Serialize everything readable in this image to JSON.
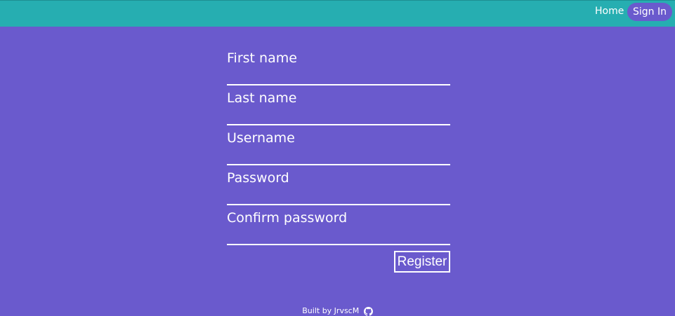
{
  "colors": {
    "background": "#6a5acd",
    "navbar": "#26aeb1",
    "text": "#ffffff"
  },
  "nav": {
    "home_label": "Home",
    "signin_label": "Sign In"
  },
  "form": {
    "fields": [
      {
        "label": "First name",
        "value": ""
      },
      {
        "label": "Last name",
        "value": ""
      },
      {
        "label": "Username",
        "value": ""
      },
      {
        "label": "Password",
        "value": ""
      },
      {
        "label": "Confirm password",
        "value": ""
      }
    ],
    "register_label": "Register"
  },
  "footer": {
    "text": "Built by JrvscM",
    "icon": "github-icon"
  }
}
